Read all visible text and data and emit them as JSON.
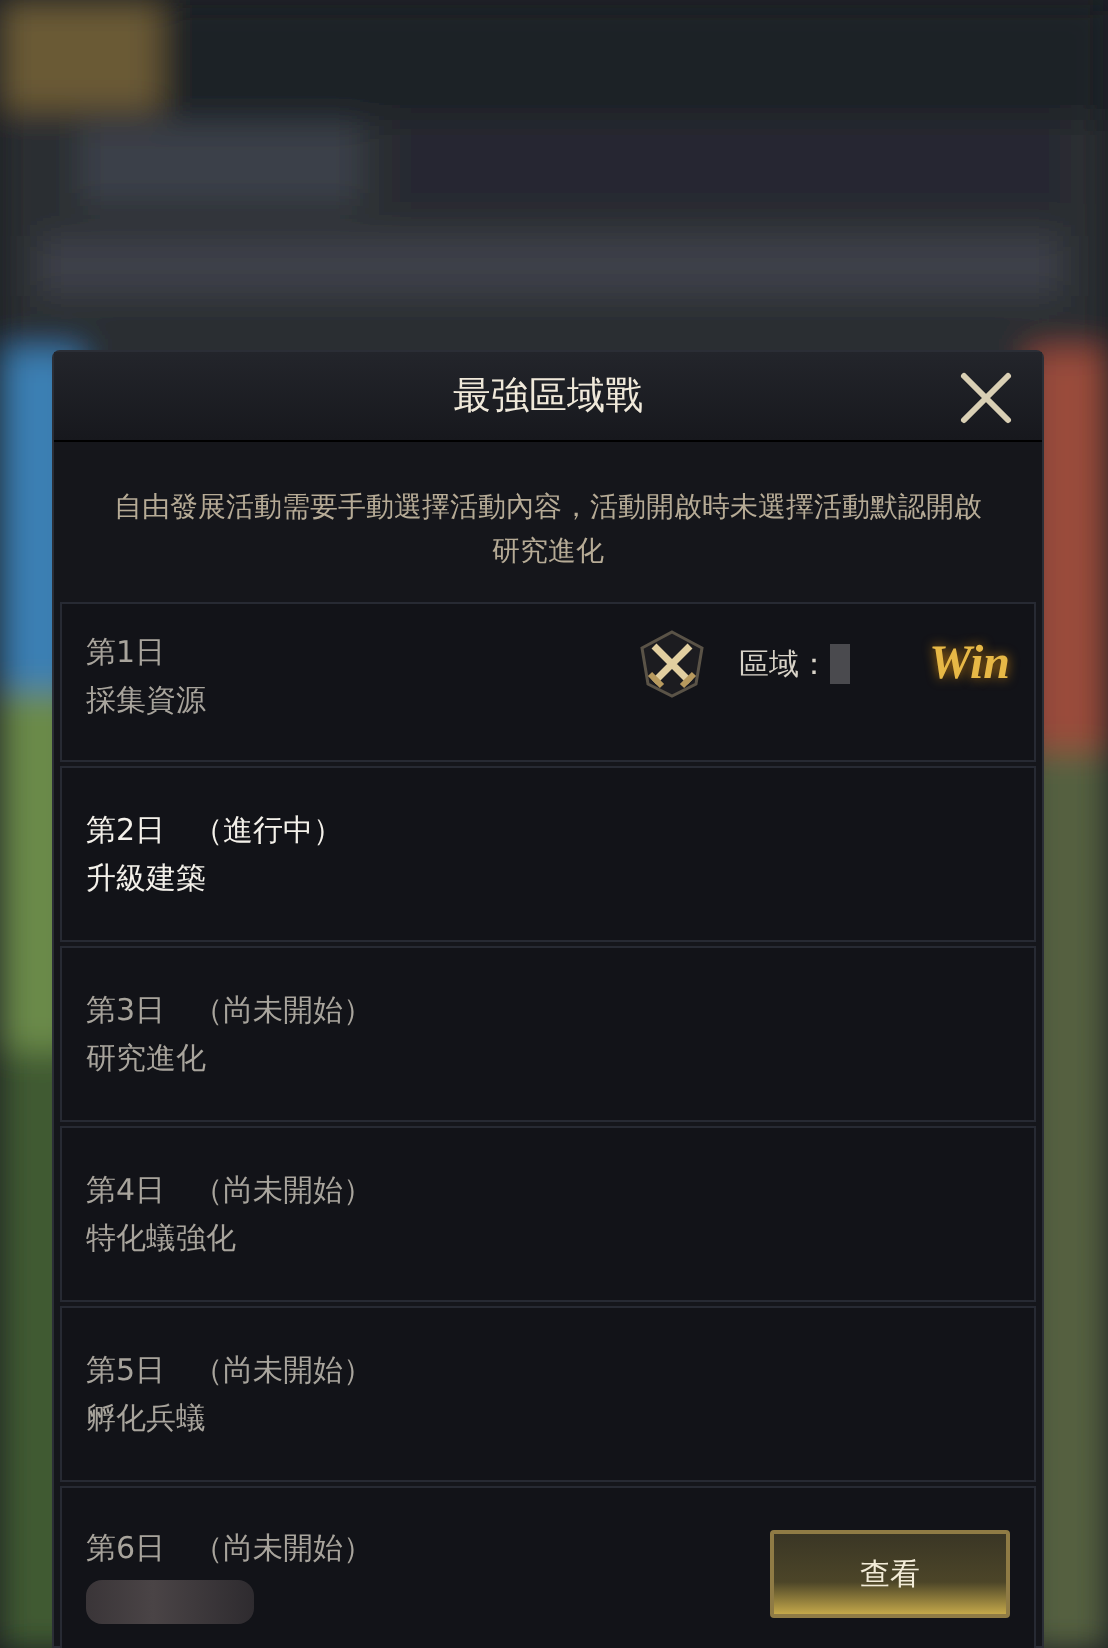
{
  "dialog": {
    "title": "最強區域戰",
    "description": "自由發展活動需要手動選擇活動內容，活動開啟時未選擇活動默認開啟研究進化"
  },
  "days": [
    {
      "day": "第1日",
      "kind": "done",
      "activity": "採集資源",
      "region_label": "區域：",
      "result": "Win"
    },
    {
      "day": "第2日",
      "kind": "active",
      "status_text": "（進行中）",
      "activity": "升級建築"
    },
    {
      "day": "第3日",
      "kind": "pending",
      "status_text": "（尚未開始）",
      "activity": "研究進化"
    },
    {
      "day": "第4日",
      "kind": "pending",
      "status_text": "（尚未開始）",
      "activity": "特化蟻強化"
    },
    {
      "day": "第5日",
      "kind": "pending",
      "status_text": "（尚未開始）",
      "activity": "孵化兵蟻"
    },
    {
      "day": "第6日",
      "kind": "pending",
      "status_text": "（尚未開始）",
      "redacted": true,
      "button": "查看"
    }
  ]
}
